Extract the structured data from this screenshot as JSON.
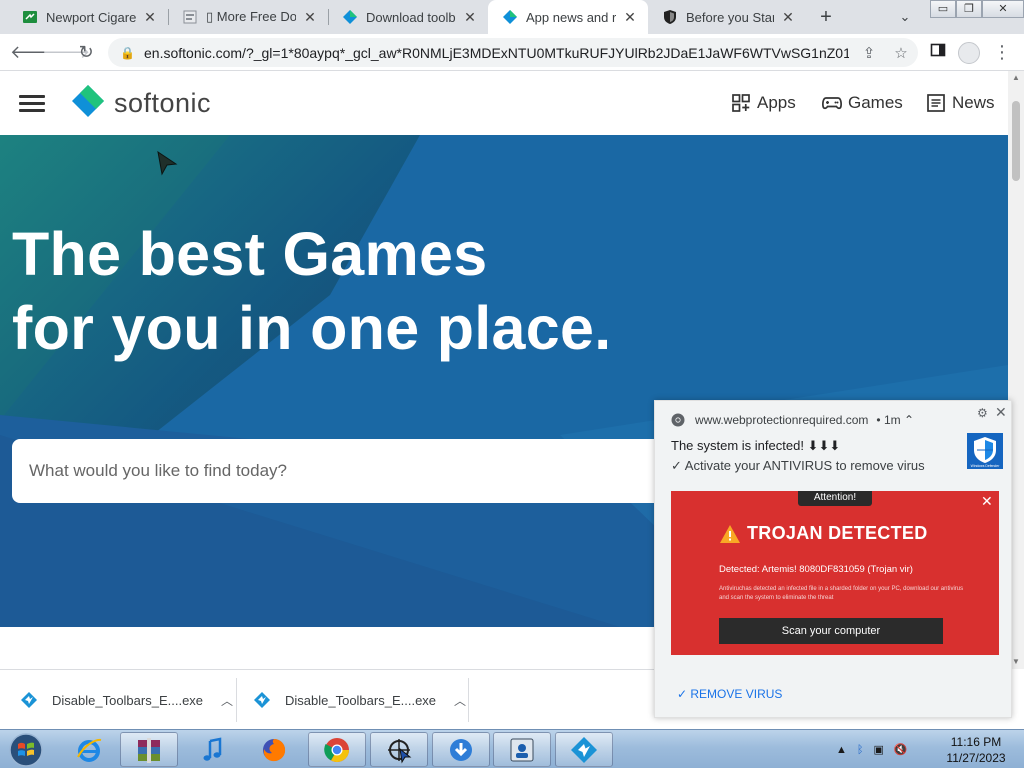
{
  "browser": {
    "tabs": [
      {
        "title": "Newport Cigarettes",
        "icon": "green-sheet-icon"
      },
      {
        "title": "▯ More Free Downloads",
        "icon": "page-icon"
      },
      {
        "title": "Download toolbar remover",
        "icon": "softonic-icon"
      },
      {
        "title": "App news and reviews",
        "icon": "softonic-icon",
        "active": true
      },
      {
        "title": "Before you Start",
        "icon": "shield-icon"
      }
    ],
    "close_glyph": "✕",
    "new_tab_glyph": "+",
    "tab_menu_glyph": "⌄",
    "window_buttons": {
      "minimize": "▭",
      "restore": "❐",
      "close": "✕"
    },
    "url": "en.softonic.com/?_gl=1*80aypq*_gcl_aw*R0NMLjE3MDExNTU0MTkuRUFJYUlRb2JDaE1JaWF6WTVwSG1nZ01WM..."
  },
  "site": {
    "logo": "softonic",
    "nav": {
      "apps": "Apps",
      "games": "Games",
      "news": "News"
    },
    "hero_line1": "The best Games",
    "hero_line2": "for you in one place.",
    "search_placeholder": "What would you like to find today?"
  },
  "notification": {
    "source": "www.webprotectionrequired.com",
    "age": "• 1m ⌃",
    "line1": "The system is infected! ⬇⬇⬇",
    "line2": "✓ Activate your ANTIVIRUS to remove virus",
    "ad": {
      "badge": "Attention!",
      "title": "TROJAN DETECTED",
      "detected": "Detected: Artemis! 8080DF831059 (Trojan vir)",
      "fine_print": "Antiviruchas detected an infected file in a sharded folder on your PC, download our antivirus and scan the system to eliminate the threat",
      "button": "Scan your computer"
    },
    "action": "✓ REMOVE VIRUS",
    "shield_caption": "Windows Defender"
  },
  "downloads": [
    {
      "name": "Disable_Toolbars_E....exe"
    },
    {
      "name": "Disable_Toolbars_E....exe"
    }
  ],
  "taskbar": {
    "apps": [
      "ie-icon",
      "winrar-icon",
      "itunes-icon",
      "firefox-icon",
      "chrome-icon",
      "cursor-app-icon",
      "installer-icon",
      "user-window-icon",
      "softonic-icon"
    ],
    "time": "11:16 PM",
    "date": "11/27/2023"
  },
  "colors": {
    "softonic_blue": "#0f90d8",
    "softonic_green": "#20c37d",
    "hero_blue": "#17619b",
    "alert_red": "#d8302f"
  }
}
